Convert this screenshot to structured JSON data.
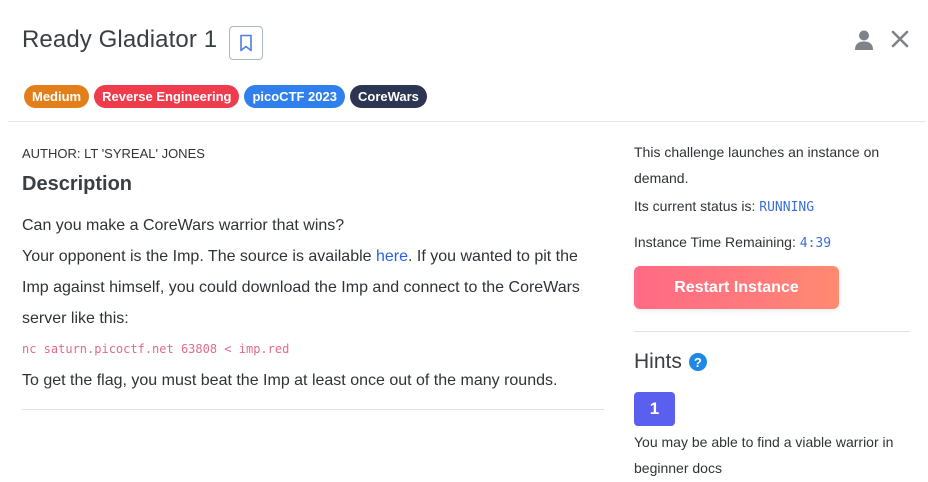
{
  "challenge": {
    "title": "Ready Gladiator 1",
    "tags": [
      {
        "label": "Medium",
        "color": "#e37f1b"
      },
      {
        "label": "Reverse Engineering",
        "color": "#ef3c4c"
      },
      {
        "label": "picoCTF 2023",
        "color": "#2f80ed"
      },
      {
        "label": "CoreWars",
        "color": "#2c3652"
      }
    ],
    "author": "AUTHOR: LT 'SYREAL' JONES",
    "description_heading": "Description",
    "description": {
      "line1": "Can you make a CoreWars warrior that wins?",
      "line2_prefix": "Your opponent is the Imp. The source is available ",
      "link_text": "here",
      "line2_suffix": ". If you wanted to pit the Imp against himself, you could download the Imp and connect to the CoreWars server like this:",
      "command": "nc saturn.picoctf.net 63808 < imp.red",
      "line_final": "To get the flag, you must beat the Imp at least once out of the many rounds."
    }
  },
  "instance": {
    "launch_text": "This challenge launches an instance on demand.",
    "status_label": "Its current status is: ",
    "status_value": "RUNNING",
    "time_label": "Instance Time Remaining: ",
    "time_value": "4:39",
    "restart_label": "Restart Instance"
  },
  "hints": {
    "heading": "Hints",
    "help_symbol": "?",
    "items": [
      {
        "number": "1",
        "text": "You may be able to find a viable warrior in beginner docs"
      }
    ]
  },
  "icons": {
    "bookmark": "bookmark-icon",
    "user": "user-icon",
    "close": "close-icon",
    "help": "help-icon"
  },
  "colors": {
    "accent_blue": "#2563eb",
    "status_mono": "#3b6fd8",
    "command_pink": "#e06b8b",
    "hint_button": "#5b5ff0",
    "restart_gradient_start": "#ff6a85",
    "restart_gradient_end": "#ff8a70"
  }
}
